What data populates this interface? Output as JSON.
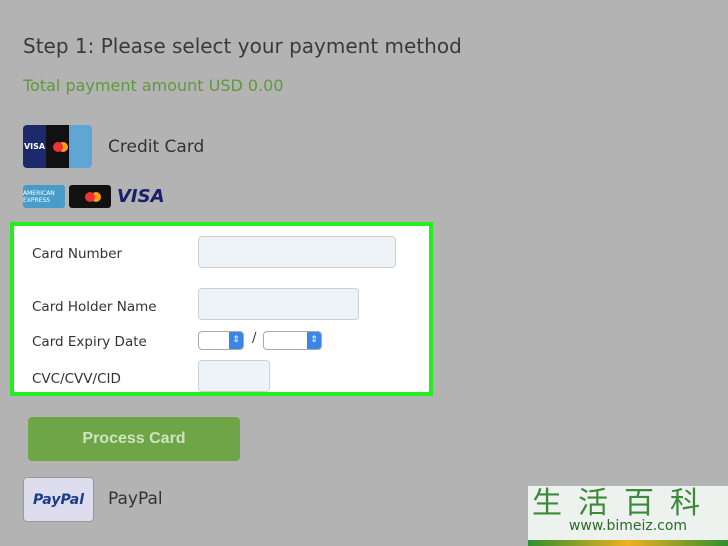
{
  "title": "Step 1: Please select your payment method",
  "total": "Total payment amount USD 0.00",
  "credit_card": {
    "label": "Credit Card",
    "brands": [
      "VISA",
      "AMERICAN EXPRESS",
      "mastercard",
      "VISA"
    ]
  },
  "form": {
    "card_number": "Card Number",
    "holder": "Card Holder Name",
    "expiry": "Card Expiry Date",
    "separator": "/",
    "cvc": "CVC/CVV/CID"
  },
  "process_label": "Process Card",
  "paypal": {
    "label": "PayPal",
    "logo": "PayPal"
  },
  "watermark": {
    "chars": "生活百科",
    "url": "www.bimeiz.com"
  },
  "highlight_color": "#22ee22"
}
